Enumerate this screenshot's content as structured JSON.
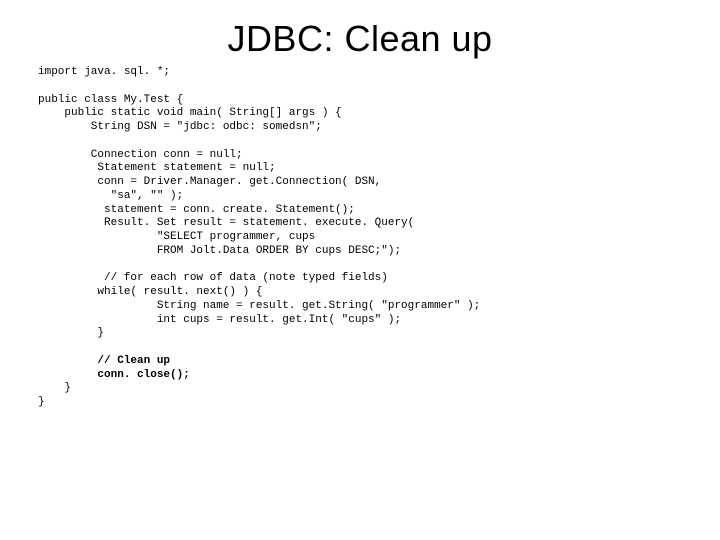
{
  "title": "JDBC: Clean up",
  "code": {
    "l01": "import java. sql. *;",
    "l02": "",
    "l03": "public class My.Test {",
    "l04": "    public static void main( String[] args ) {",
    "l05": "        String DSN = \"jdbc: odbc: somedsn\";",
    "l06": "",
    "l07": "        Connection conn = null;",
    "l08": "         Statement statement = null;",
    "l09": "         conn = Driver.Manager. get.Connection( DSN,",
    "l10": "           \"sa\", \"\" );",
    "l11": "          statement = conn. create. Statement();",
    "l12": "          Result. Set result = statement. execute. Query(",
    "l13": "                  \"SELECT programmer, cups",
    "l14": "                  FROM Jolt.Data ORDER BY cups DESC;\");",
    "l15": "",
    "l16": "          // for each row of data (note typed fields)",
    "l17": "         while( result. next() ) {",
    "l18": "                  String name = result. get.String( \"programmer\" );",
    "l19": "                  int cups = result. get.Int( \"cups\" );",
    "l20": "         }",
    "l21": "",
    "l22": "         // Clean up",
    "l23": "         conn. close();",
    "l24": "    }",
    "l25": "}"
  }
}
